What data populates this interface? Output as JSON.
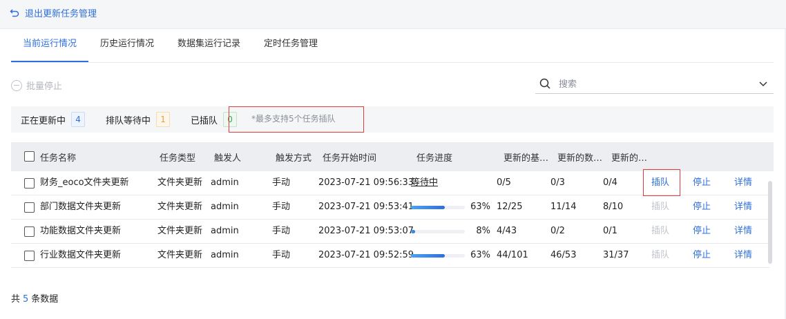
{
  "header": {
    "back_label": "退出更新任务管理"
  },
  "tabs": [
    {
      "label": "当前运行情况",
      "active": true
    },
    {
      "label": "历史运行情况",
      "active": false
    },
    {
      "label": "数据集运行记录",
      "active": false
    },
    {
      "label": "定时任务管理",
      "active": false
    }
  ],
  "toolbar": {
    "batch_stop_label": "批量停止"
  },
  "search": {
    "placeholder": "搜索"
  },
  "status": {
    "updating_label": "正在更新中",
    "updating_count": "4",
    "waiting_label": "排队等待中",
    "waiting_count": "1",
    "queued_label": "已插队",
    "queued_count": "0",
    "tip": "*最多支持5个任务插队"
  },
  "table": {
    "headers": [
      "任务名称",
      "任务类型",
      "触发人",
      "触发方式",
      "任务开始时间",
      "任务进度",
      "更新的基…",
      "更新的数…",
      "更新的…"
    ],
    "rows": [
      {
        "name": "财务_eoco文件夹更新",
        "type": "文件夹更新",
        "trigger_user": "admin",
        "trigger_mode": "手动",
        "start_time": "2023-07-21 09:56:33",
        "progress_text": "等待中",
        "progress": null,
        "c1": "0/5",
        "c2": "0/3",
        "c3": "0/4",
        "a1": "插队",
        "a1_enabled": true,
        "a2": "停止",
        "a3": "详情"
      },
      {
        "name": "部门数据文件夹更新",
        "type": "文件夹更新",
        "trigger_user": "admin",
        "trigger_mode": "手动",
        "start_time": "2023-07-21 09:53:41",
        "progress_text": "63%",
        "progress": 0.63,
        "c1": "12/25",
        "c2": "11/14",
        "c3": "8/10",
        "a1": "插队",
        "a1_enabled": false,
        "a2": "停止",
        "a3": "详情"
      },
      {
        "name": "功能数据文件夹更新",
        "type": "文件夹更新",
        "trigger_user": "admin",
        "trigger_mode": "手动",
        "start_time": "2023-07-21 09:53:07",
        "progress_text": "8%",
        "progress": 0.08,
        "c1": "4/43",
        "c2": "0/2",
        "c3": "0/1",
        "a1": "插队",
        "a1_enabled": false,
        "a2": "停止",
        "a3": "详情"
      },
      {
        "name": "行业数据文件夹更新",
        "type": "文件夹更新",
        "trigger_user": "admin",
        "trigger_mode": "手动",
        "start_time": "2023-07-21 09:52:59",
        "progress_text": "63%",
        "progress": 0.63,
        "c1": "44/101",
        "c2": "46/53",
        "c3": "31/37",
        "a1": "插队",
        "a1_enabled": false,
        "a2": "停止",
        "a3": "详情"
      }
    ]
  },
  "footer": {
    "prefix": "共",
    "count": "5",
    "suffix": "条数据"
  },
  "colors": {
    "accent": "#2f6fdc",
    "highlight": "#e23b3b"
  }
}
